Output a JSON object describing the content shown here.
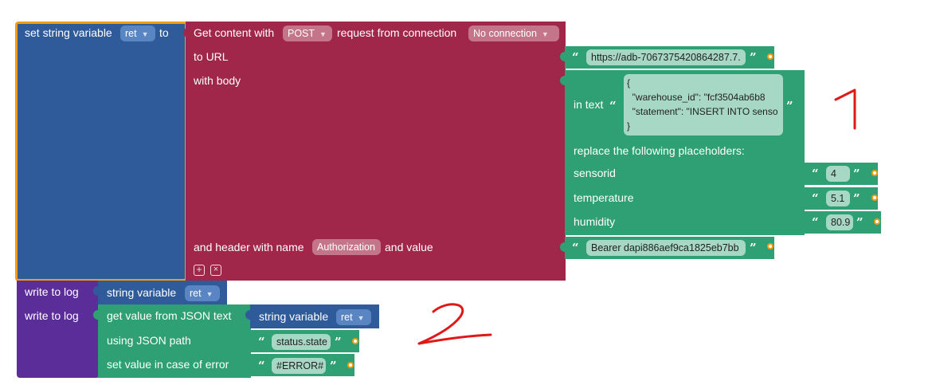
{
  "colors": {
    "string_var": "#2f5b9b",
    "http": "#a0264a",
    "text": "#2ea073",
    "log": "#5b2d98",
    "selected": "#f39c12",
    "annotation": "#e01818"
  },
  "set_var": {
    "prefix": "set string variable",
    "var_name": "ret",
    "suffix": "to"
  },
  "http": {
    "label_get": "Get content with",
    "method": "POST",
    "label_request": "request from connection",
    "connection": "No connection",
    "label_url": "to URL",
    "label_body": "with body",
    "label_header": "and header with name",
    "header_name": "Authorization",
    "label_value": "and value",
    "add_icon": "plus-icon",
    "remove_icon": "x-icon"
  },
  "url_text": "https://adb-7067375420864287.7.",
  "body": {
    "label_in_text": "in text",
    "json_lines": [
      "{",
      "  \"warehouse_id\": \"fcf3504ab6b8",
      "  \"statement\": \"INSERT INTO senso",
      "}"
    ],
    "label_replace": "replace the following placeholders:",
    "placeholders": [
      {
        "name": "sensorid",
        "value": "4"
      },
      {
        "name": "temperature",
        "value": "5.1"
      },
      {
        "name": "humidity",
        "value": "80.9"
      }
    ]
  },
  "header_value": "Bearer dapi886aef9ca1825eb7bb",
  "log1": {
    "label": "write to log",
    "var_label": "string variable",
    "var_name": "ret"
  },
  "log2": {
    "label": "write to log",
    "label_get_value": "get value from JSON text",
    "var_label": "string variable",
    "var_name": "ret",
    "label_path": "using JSON path",
    "path": "status.state",
    "label_error": "set value in case of error",
    "error_value": "#ERROR#"
  },
  "annotations": {
    "one": "1",
    "two": "2"
  }
}
